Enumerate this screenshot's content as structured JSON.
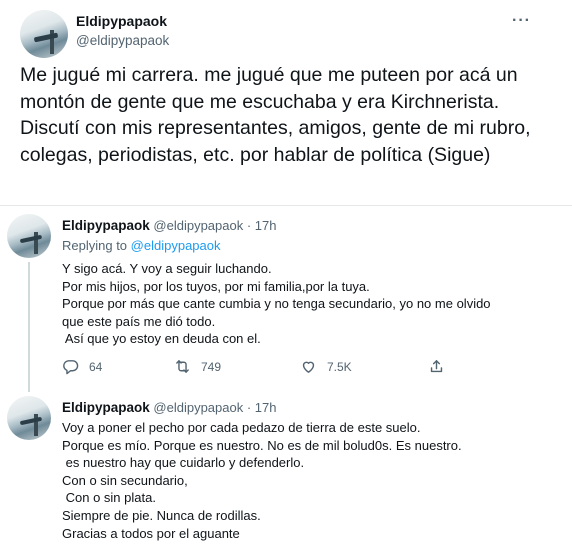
{
  "main_tweet": {
    "name": "Eldipypapaok",
    "handle": "@eldipypapaok",
    "more_icon": "more-horizontal-icon",
    "text": "Me jugué mi carrera. me jugué que me puteen por acá un montón de gente que me escuchaba y era Kirchnerista. Discutí con mis representantes, amigos, gente de mi rubro, colegas, periodistas, etc. por hablar de política (Sigue)"
  },
  "reply_tweet": {
    "name": "Eldipypapaok",
    "handle": "@eldipypapaok",
    "time": "· 17h",
    "replying_prefix": "Replying to",
    "replying_to": "@eldipypapaok",
    "lines": [
      "Y sigo acá. Y voy a seguir luchando.",
      "Por mis hijos, por los tuyos, por mi familia,por la tuya.",
      "Porque por más que cante cumbia y no tenga secundario, yo no me olvido",
      "que este país me dió todo.",
      " Así que yo estoy en deuda con el."
    ],
    "actions": {
      "replies": "64",
      "retweets": "749",
      "likes": "7.5K"
    }
  },
  "third_tweet": {
    "name": "Eldipypapaok",
    "handle": "@eldipypapaok",
    "time": "· 17h",
    "lines": [
      "Voy a poner el pecho por cada pedazo de tierra de este suelo.",
      "Porque es mío. Porque es nuestro. No es de mil bolud0s. Es nuestro.",
      " es nuestro hay que cuidarlo y defenderlo.",
      "Con o sin secundario,",
      " Con o sin plata.",
      "Siempre de pie. Nunca de rodillas.",
      "Gracias a todos por el aguante"
    ]
  }
}
